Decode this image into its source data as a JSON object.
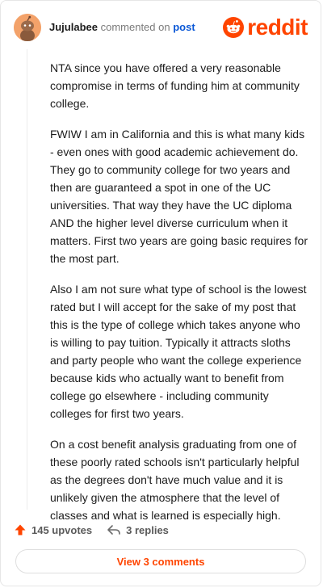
{
  "header": {
    "username": "Jujulabee",
    "action_text": "commented on",
    "post_link": "post",
    "logo_text": "reddit",
    "avatar_icon": "snoo-avatar-icon",
    "logo_icon": "reddit-snoo-icon"
  },
  "comment": {
    "paragraphs": [
      "NTA since you have offered a very reasonable compromise in terms of funding him at community college.",
      "FWIW I am in California and this is what many kids - even ones with good academic achievement do. They go to community college for two years and then are guaranteed a spot in one of the UC universities. That way they have the UC diploma AND the higher level diverse curriculum when it matters. First two years are going basic requires for the most part.",
      "Also I am not sure what type of school is the lowest rated but I will accept for the sake of my post that this is the type of college which takes anyone who is willing to pay tuition. Typically it attracts sloths and party people who want the college experience because kids who actually want to benefit from college go elsewhere - including community colleges for first two years.",
      "On a cost benefit analysis graduating from one of these poorly rated schools isn't particularly helpful as the degrees don't have much value and it is unlikely given the atmosphere that the level of classes and what is learned is especially high."
    ]
  },
  "actions": {
    "upvotes": "145 upvotes",
    "replies": "3 replies",
    "upvote_icon": "upvote-arrow-icon",
    "reply_icon": "reply-arrow-icon"
  },
  "footer": {
    "view_comments": "View 3 comments"
  },
  "colors": {
    "brand": "#ff4500",
    "link": "#0b58d6",
    "avatar_bg": "#f3a26a"
  }
}
